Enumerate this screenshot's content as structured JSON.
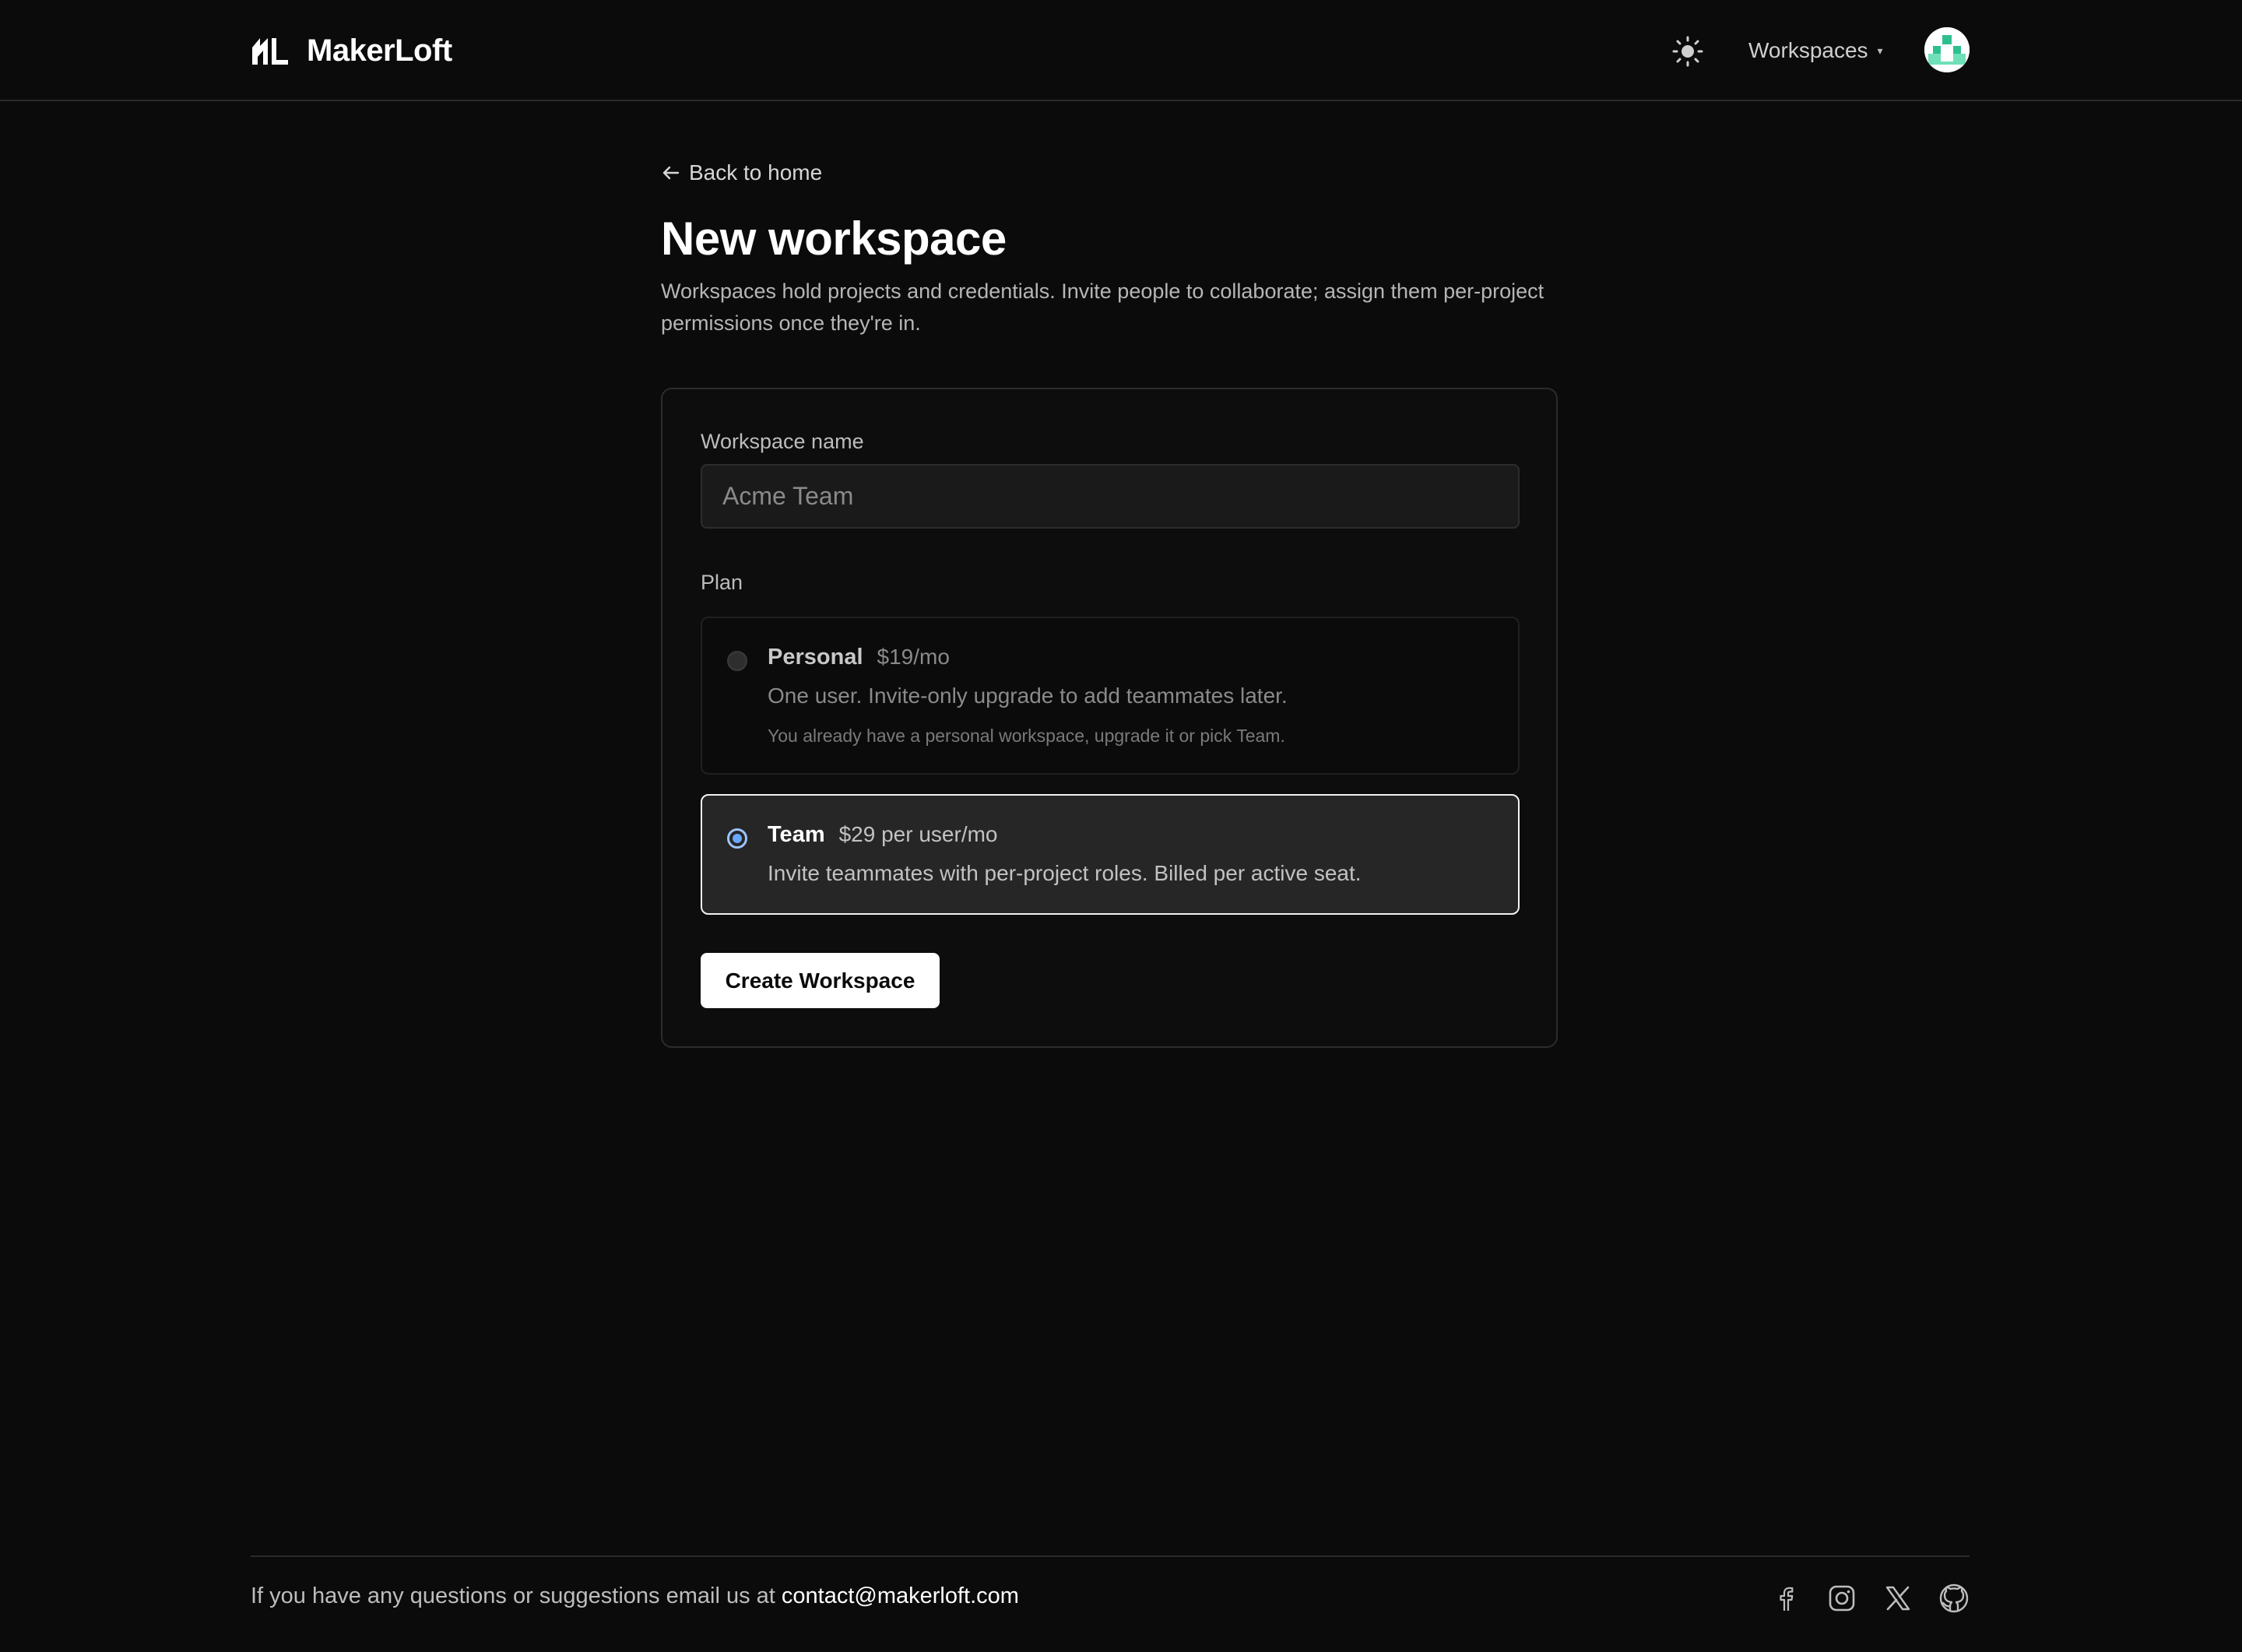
{
  "header": {
    "brand_name": "MakerLoft",
    "logo_icon": "makerloft-logo",
    "theme_icon": "sun-icon",
    "workspaces_label": "Workspaces",
    "caret": "▾",
    "avatar_icon": "user-avatar"
  },
  "main": {
    "back_label": "Back to home",
    "title": "New workspace",
    "subtitle": "Workspaces hold projects and credentials. Invite people to collaborate; assign them per-project permissions once they're in."
  },
  "form": {
    "name_label": "Workspace name",
    "name_value": "",
    "name_placeholder": "Acme Team",
    "plan_label": "Plan",
    "plans": [
      {
        "name": "Personal",
        "price": "$19/mo",
        "description": "One user. Invite-only upgrade to add teammates later.",
        "note": "You already have a personal workspace, upgrade it or pick Team.",
        "selected": false,
        "disabled": true
      },
      {
        "name": "Team",
        "price": "$29 per user/mo",
        "description": "Invite teammates with per-project roles. Billed per active seat.",
        "selected": true,
        "disabled": false
      }
    ],
    "submit_label": "Create Workspace"
  },
  "footer": {
    "text": "If you have any questions or suggestions email us at ",
    "email": "contact@makerloft.com",
    "socials": [
      "facebook-icon",
      "instagram-icon",
      "x-icon",
      "github-icon"
    ]
  },
  "colors": {
    "background": "#0b0b0b",
    "card_border": "#2c2c2c",
    "selected_radio": "#6aa8ff",
    "button_bg": "#ffffff"
  }
}
